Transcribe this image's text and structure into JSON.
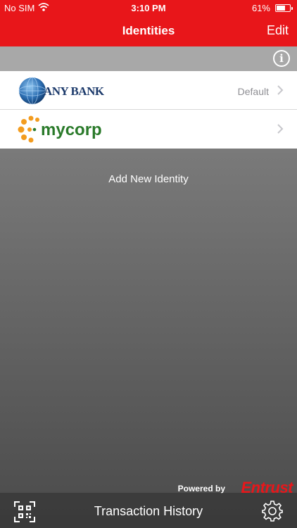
{
  "status_bar": {
    "carrier": "No SIM",
    "time": "3:10 PM",
    "battery": "61%",
    "battery_level": 0.61
  },
  "nav": {
    "title": "Identities",
    "edit_label": "Edit"
  },
  "identities": [
    {
      "name": "ANY BANK",
      "badge": "Default"
    },
    {
      "name": "mycorp",
      "badge": ""
    }
  ],
  "main": {
    "add_label": "Add New Identity"
  },
  "footer": {
    "powered_by": "Powered by",
    "brand": "Entrust",
    "tab_label": "Transaction History"
  },
  "colors": {
    "accent": "#e8161a",
    "background": "#555555"
  },
  "icons": [
    "wifi-icon",
    "battery-icon",
    "info-icon",
    "chevron-right-icon",
    "qr-code-icon",
    "gear-icon"
  ]
}
